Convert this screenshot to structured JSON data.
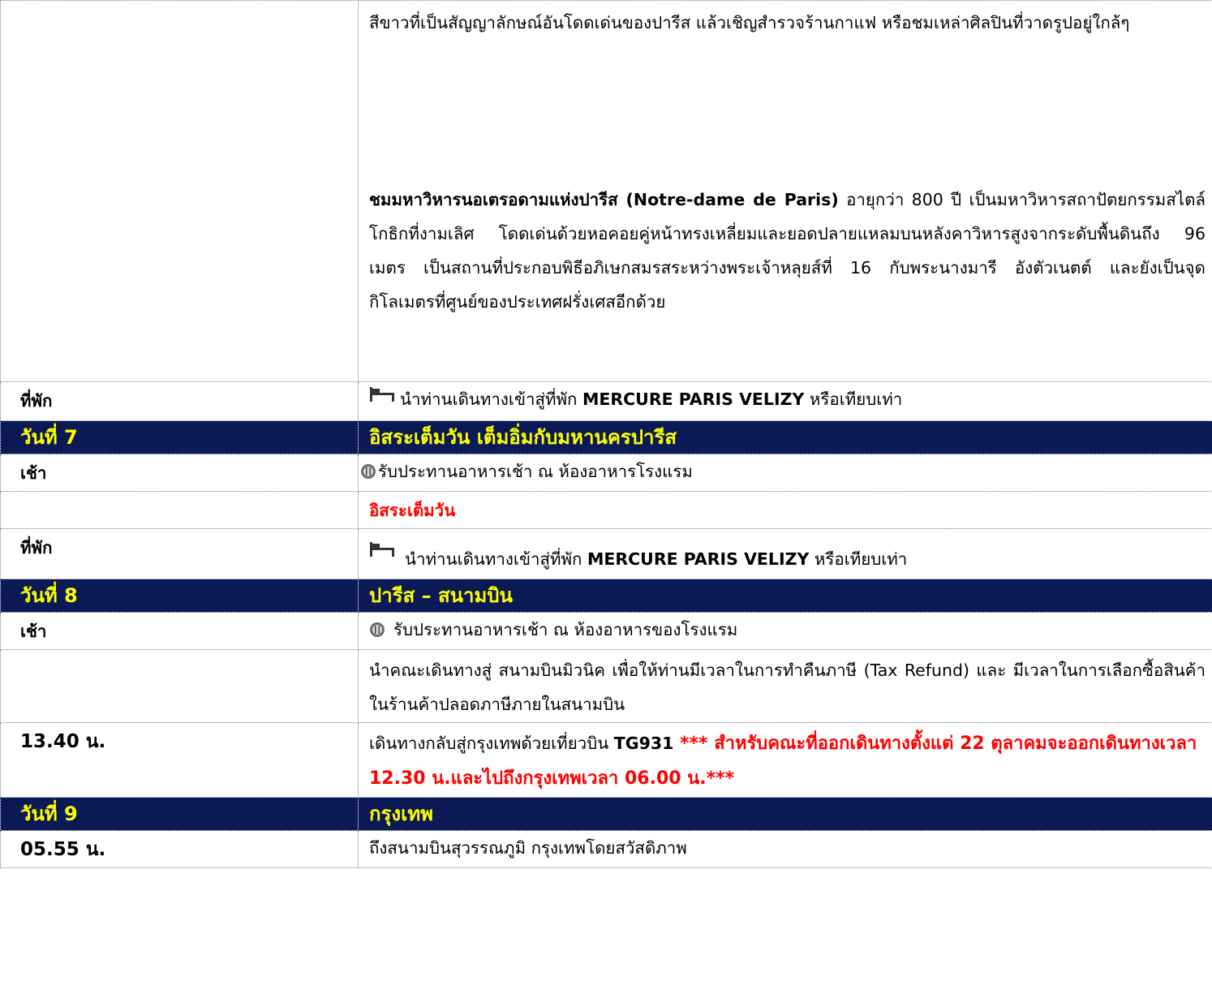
{
  "rows": {
    "intro_text": "สีขาวที่เป็นสัญญาลักษณ์อันโดดเด่นของปารีส แล้วเชิญสำรวจร้านกาแฟ หรือชมเหล่าศิลปินที่วาดรูปอยู่ใกล้ๆ",
    "notre": {
      "lead": "ชม",
      "name": "มหาวิหารนอเตรอดามแห่งปารีส (Notre-dame de Paris)",
      "text": " อายุกว่า 800 ปี เป็นมหาวิหารสถาปัตยกรรมสไตล์โกธิกที่งามเลิศ โดดเด่นด้วยหอคอยคู่หน้าทรงเหลี่ยมและยอดปลายแหลมบนหลังคาวิหารสูงจากระดับพื้นดินถึง 96 เมตร เป็นสถานที่ประกอบพิธีอภิเษกสมรสระหว่างพระเจ้าหลุยส์ที่ 16 กับพระนางมารี อังตัวเนตต์ และยังเป็นจุดกิโลเมตรที่ศูนย์ของประเทศฝรั่งเศสอีกด้วย"
    },
    "stay1": {
      "label": "ที่พัก",
      "prefix": "นำท่านเดินทางเข้าสู่ที่พัก ",
      "hotel": "MERCURE PARIS VELIZY",
      "suffix": " หรือเทียบเท่า"
    },
    "day7": {
      "label": "วันที่ 7",
      "title": "อิสระเต็มวัน เต็มอิ่มกับมหานครปารีส"
    },
    "breakfast1": {
      "label": "เช้า",
      "text": "รับประทานอาหารเช้า ณ ห้องอาหารโรงแรม"
    },
    "free_day": "อิสระเต็มวัน",
    "stay2": {
      "label": "ที่พัก",
      "prefix": "นำท่านเดินทางเข้าสู่ที่พัก ",
      "hotel": "MERCURE PARIS VELIZY",
      "suffix": " หรือเทียบเท่า"
    },
    "day8": {
      "label": "วันที่ 8",
      "title": "ปารีส – สนามบิน"
    },
    "breakfast2": {
      "label": "เช้า",
      "text": "รับประทานอาหารเช้า ณ ห้องอาหารของโรงแรม"
    },
    "airport_text": "นำคณะเดินทางสู่ สนามบินมิวนิค เพื่อให้ท่านมีเวลาในการทำคืนภาษี (Tax Refund) และ มีเวลาในการเลือกซื้อสินค้าในร้านค้าปลอดภาษีภายในสนามบิน",
    "flight": {
      "time": "13.40  น.",
      "prefix": "เดินทางกลับสู่กรุงเทพด้วยเที่ยวบิน ",
      "code": "TG931",
      "note": " *** สำหรับคณะที่ออกเดินทางตั้งแต่ 22 ตุลาคมจะออกเดินทางเวลา 12.30 น.และไปถึงกรุงเทพเวลา 06.00 น.***"
    },
    "day9": {
      "label": "วันที่ 9",
      "title": "กรุงเทพ"
    },
    "arrival": {
      "time": "05.55 น.",
      "text": "ถึงสนามบินสุวรรณภูมิ กรุงเทพโดยสวัสดิภาพ"
    }
  },
  "colors": {
    "day_header_bg": "#0b1a55",
    "day_header_text": "#ffff00",
    "highlight_red": "#ff0000"
  },
  "icons": {
    "hotel": "bed-icon",
    "meal": "breakfast-icon"
  }
}
